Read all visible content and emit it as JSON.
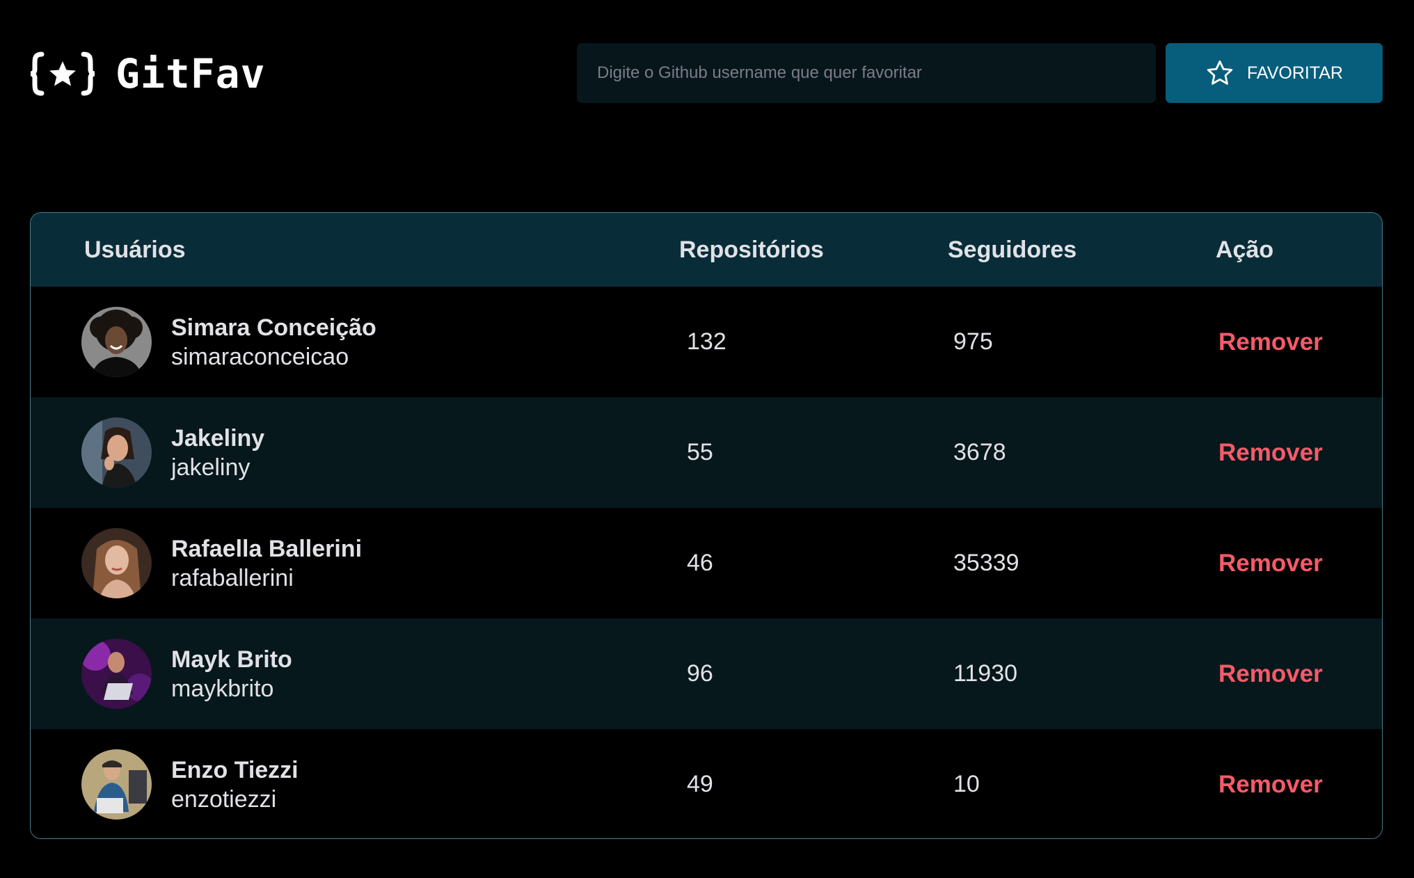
{
  "header": {
    "logo_text": "GitFav",
    "search_placeholder": "Digite o Github username que quer favoritar",
    "search_value": "",
    "favorite_button_label": "FAVORITAR"
  },
  "table": {
    "columns": [
      "Usuários",
      "Repositórios",
      "Seguidores",
      "Ação"
    ],
    "rows": [
      {
        "name": "Simara Conceição",
        "login": "simaraconceicao",
        "repositories": "132",
        "followers": "975",
        "action": "Remover"
      },
      {
        "name": "Jakeliny",
        "login": "jakeliny",
        "repositories": "55",
        "followers": "3678",
        "action": "Remover"
      },
      {
        "name": "Rafaella Ballerini",
        "login": "rafaballerini",
        "repositories": "46",
        "followers": "35339",
        "action": "Remover"
      },
      {
        "name": "Mayk Brito",
        "login": "maykbrito",
        "repositories": "96",
        "followers": "11930",
        "action": "Remover"
      },
      {
        "name": "Enzo Tiezzi",
        "login": "enzotiezzi",
        "repositories": "49",
        "followers": "10",
        "action": "Remover"
      }
    ]
  },
  "colors": {
    "background": "#000000",
    "header_row": "#092d38",
    "striped_row": "#06181c",
    "button": "#065e7c",
    "remove": "#f75a68",
    "input": "#06161b"
  },
  "icons": {
    "logo": "braces-star-icon",
    "favorite_button": "star-outline-icon"
  }
}
